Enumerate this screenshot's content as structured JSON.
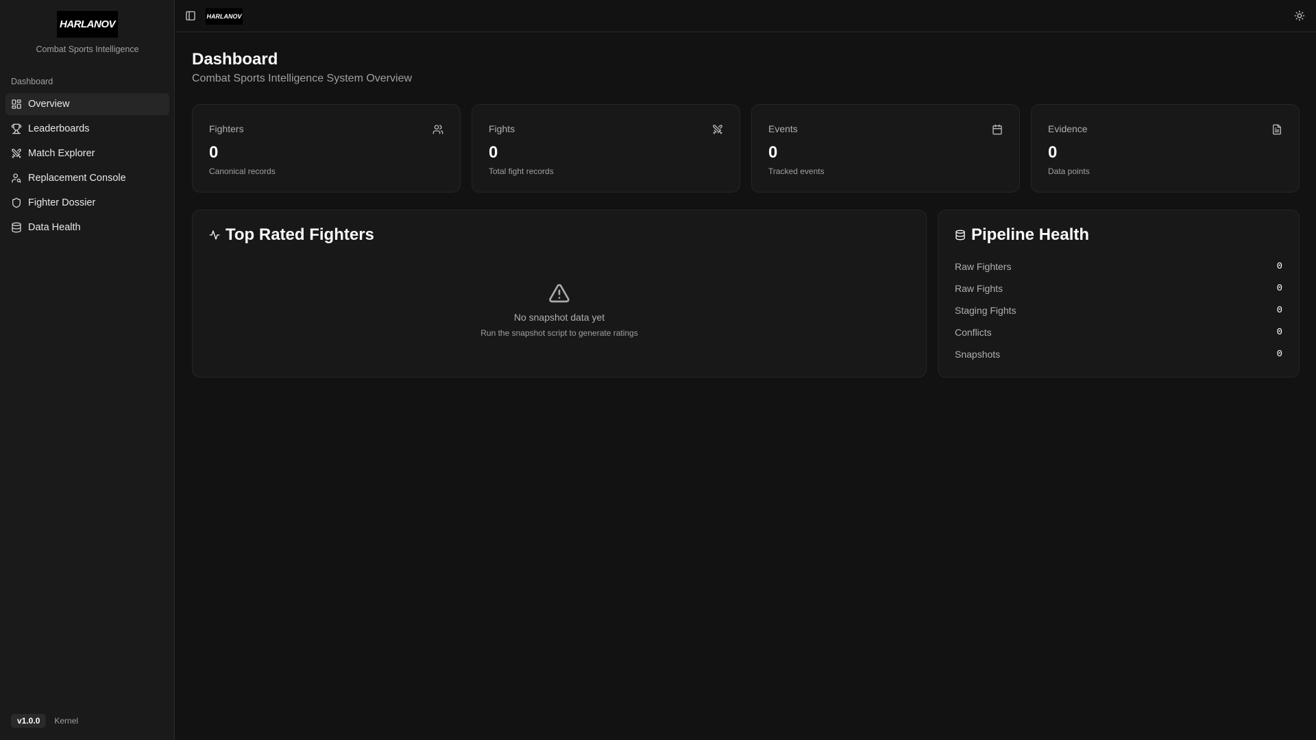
{
  "sidebar": {
    "logo_text": "HARLANOV",
    "tagline": "Combat Sports Intelligence",
    "group_label": "Dashboard",
    "items": [
      {
        "label": "Overview",
        "icon": "layout-dashboard-icon"
      },
      {
        "label": "Leaderboards",
        "icon": "trophy-icon"
      },
      {
        "label": "Match Explorer",
        "icon": "swords-icon"
      },
      {
        "label": "Replacement Console",
        "icon": "user-search-icon"
      },
      {
        "label": "Fighter Dossier",
        "icon": "shield-icon"
      },
      {
        "label": "Data Health",
        "icon": "database-icon"
      }
    ],
    "version": "v1.0.0",
    "kernel": "Kernel"
  },
  "topbar": {
    "logo_text": "HARLANOV"
  },
  "header": {
    "title": "Dashboard",
    "subtitle": "Combat Sports Intelligence System Overview"
  },
  "stats": [
    {
      "label": "Fighters",
      "value": "0",
      "desc": "Canonical records"
    },
    {
      "label": "Fights",
      "value": "0",
      "desc": "Total fight records"
    },
    {
      "label": "Events",
      "value": "0",
      "desc": "Tracked events"
    },
    {
      "label": "Evidence",
      "value": "0",
      "desc": "Data points"
    }
  ],
  "top_rated": {
    "title": "Top Rated Fighters",
    "empty_title": "No snapshot data yet",
    "empty_desc": "Run the snapshot script to generate ratings"
  },
  "pipeline": {
    "title": "Pipeline Health",
    "rows": [
      {
        "label": "Raw Fighters",
        "value": "0"
      },
      {
        "label": "Raw Fights",
        "value": "0"
      },
      {
        "label": "Staging Fights",
        "value": "0"
      },
      {
        "label": "Conflicts",
        "value": "0"
      },
      {
        "label": "Snapshots",
        "value": "0"
      }
    ]
  }
}
